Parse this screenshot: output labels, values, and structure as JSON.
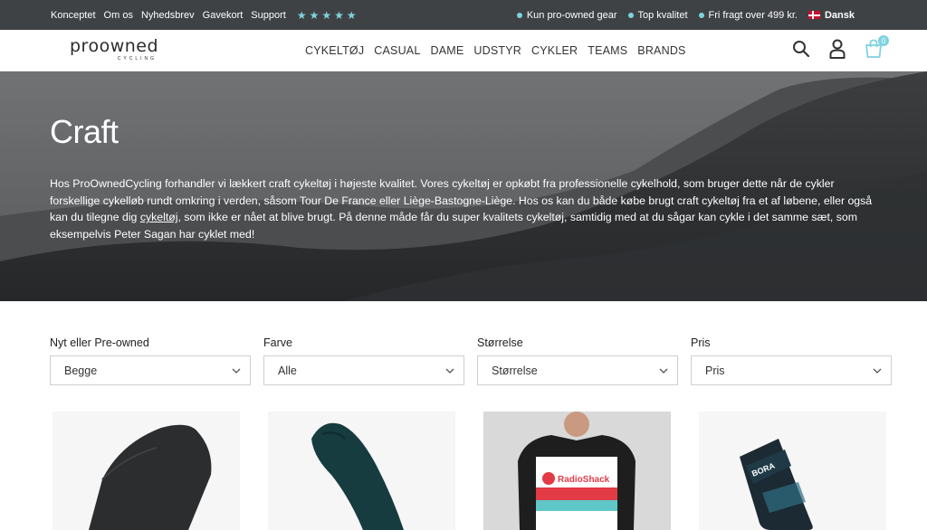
{
  "topbar": {
    "links": [
      "Konceptet",
      "Om os",
      "Nyhedsbrev",
      "Gavekort",
      "Support"
    ],
    "stars": 5,
    "usps": [
      "Kun pro-owned gear",
      "Top kvalitet",
      "Fri fragt over 499 kr."
    ],
    "language": "Dansk",
    "accent_color": "#7fd3e0",
    "bg_color": "#3f4245"
  },
  "header": {
    "logo_text": "proowned",
    "logo_sub": "CYCLING",
    "nav": [
      "CYKELTØJ",
      "CASUAL",
      "DAME",
      "UDSTYR",
      "CYKLER",
      "TEAMS",
      "BRANDS"
    ],
    "icons": [
      "search-icon",
      "account-icon",
      "cart-icon"
    ],
    "cart_count": "0"
  },
  "hero": {
    "title": "Craft",
    "description_before_link": "Hos ProOwnedCycling forhandler vi lækkert craft cykeltøj i højeste kvalitet. Vores cykeltøj er opkøbt fra professionelle cykelhold, som bruger dette når de cykler forskellige cykelløb rundt omkring i verden, såsom Tour De France eller Liège-Bastogne-Liège. Hos os kan du både købe brugt craft cykeltøj fra et af løbene, eller også kan du tilegne dig ",
    "description_link": "cykeltøj",
    "description_after_link": ", som ikke er nået at blive brugt. På denne måde får du super kvalitets cykeltøj, samtidig med at du sågar kan cykle i det samme sæt, som eksempelvis Peter Sagan har cyklet med!"
  },
  "filters": [
    {
      "label": "Nyt eller Pre-owned",
      "value": "Begge"
    },
    {
      "label": "Farve",
      "value": "Alle"
    },
    {
      "label": "Størrelse",
      "value": "Størrelse"
    },
    {
      "label": "Pris",
      "value": "Pris"
    }
  ],
  "products": [
    {
      "kind": "knee-warmer"
    },
    {
      "kind": "arm-warmer"
    },
    {
      "kind": "jersey",
      "print": "RadioShack"
    },
    {
      "kind": "sock",
      "print": "BORA"
    }
  ]
}
